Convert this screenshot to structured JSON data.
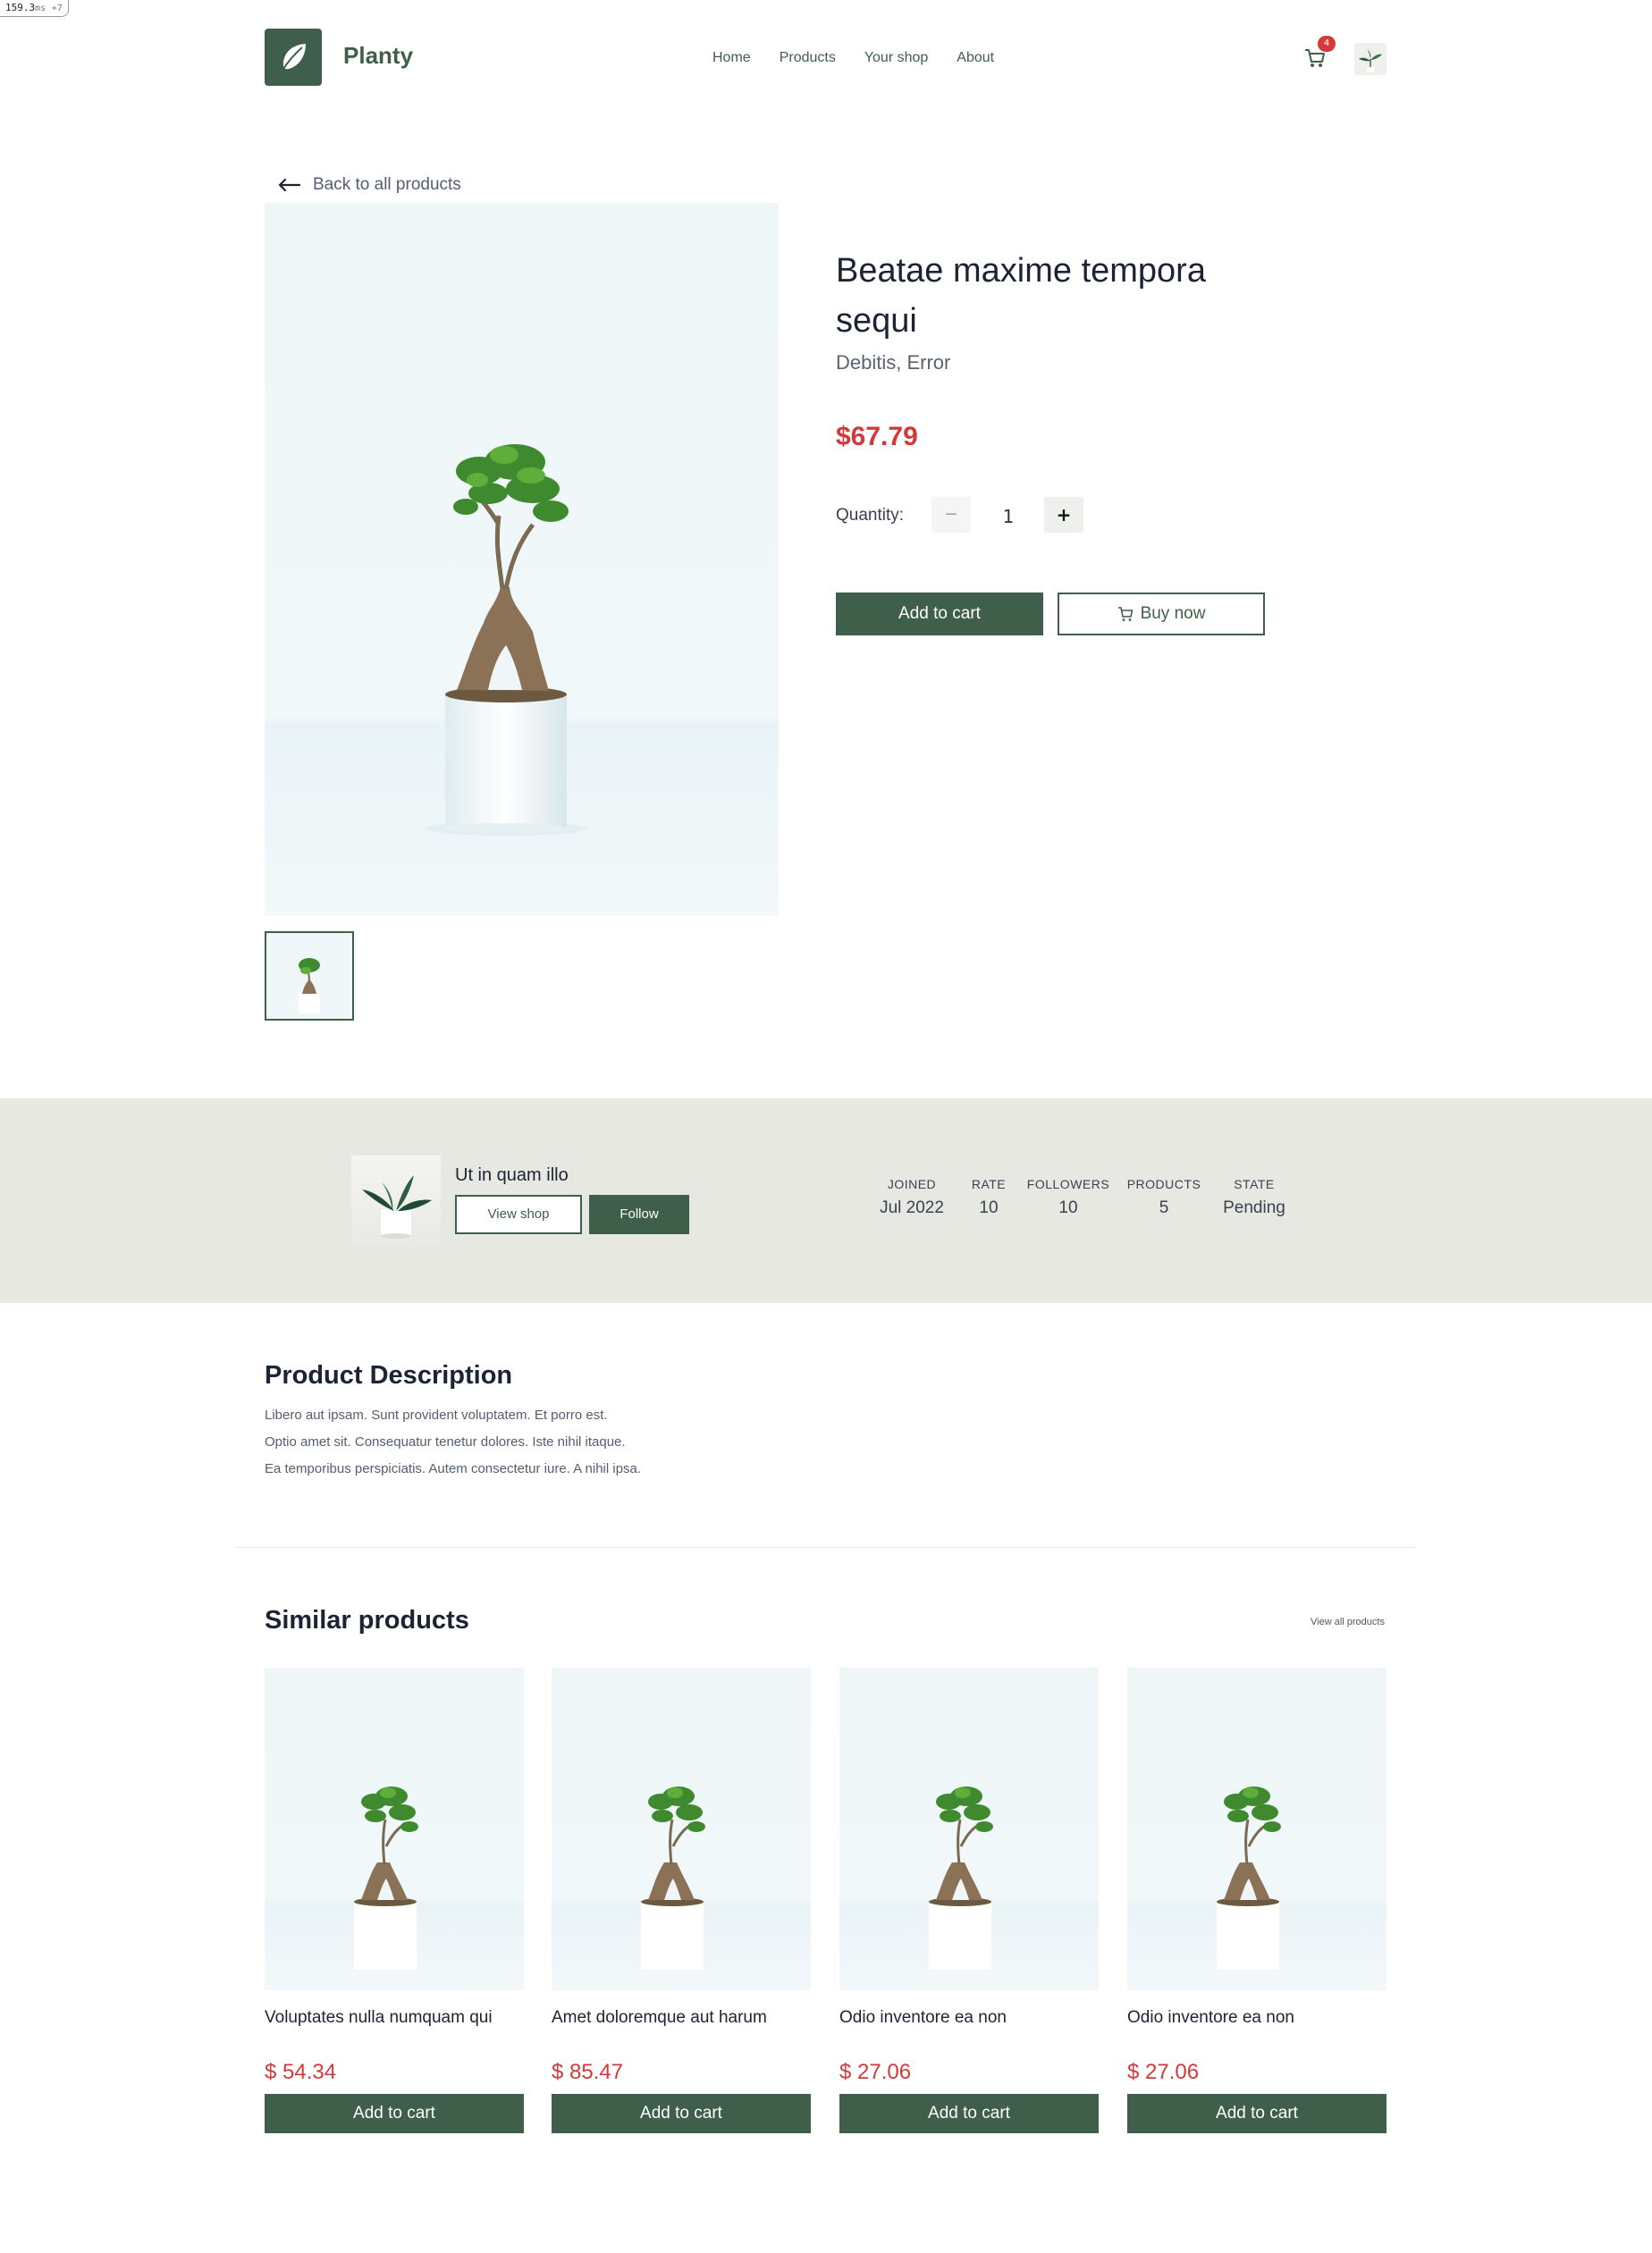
{
  "perf": {
    "value": "159.3",
    "unit": "ms",
    "extra": "+7"
  },
  "header": {
    "brand": "Planty",
    "nav": [
      "Home",
      "Products",
      "Your shop",
      "About"
    ],
    "cart_count": "4"
  },
  "product": {
    "back_label": "Back to all products",
    "title": "Beatae maxime tempora sequi",
    "categories": "Debitis, Error",
    "price": "$67.79",
    "quantity_label": "Quantity:",
    "quantity_minus": "−",
    "quantity_value": "1",
    "quantity_plus": "+",
    "add_to_cart": "Add to cart",
    "buy_now": "Buy now"
  },
  "seller": {
    "name": "Ut in quam illo",
    "view_shop": "View shop",
    "follow": "Follow",
    "stats": [
      {
        "label": "JOINED",
        "value": "Jul 2022"
      },
      {
        "label": "RATE",
        "value": "10"
      },
      {
        "label": "FOLLOWERS",
        "value": "10"
      },
      {
        "label": "PRODUCTS",
        "value": "5"
      },
      {
        "label": "STATE",
        "value": "Pending"
      }
    ]
  },
  "description": {
    "title": "Product Description",
    "lines": [
      "Libero aut ipsam. Sunt provident voluptatem. Et porro est.",
      "Optio amet sit. Consequatur tenetur dolores. Iste nihil itaque.",
      "Ea temporibus perspiciatis. Autem consectetur iure. A nihil ipsa."
    ]
  },
  "similar": {
    "title": "Similar products",
    "view_all": "View all products",
    "items": [
      {
        "name": "Voluptates nulla numquam qui",
        "price": "$ 54.34",
        "button": "Add to cart"
      },
      {
        "name": "Amet doloremque aut harum",
        "price": "$ 85.47",
        "button": "Add to cart"
      },
      {
        "name": "Odio inventore ea non",
        "price": "$ 27.06",
        "button": "Add to cart"
      },
      {
        "name": "Odio inventore ea non",
        "price": "$ 27.06",
        "button": "Add to cart"
      }
    ]
  },
  "colors": {
    "brand": "#3f5f4a",
    "price": "#d23a3a",
    "band": "#e7e8e2"
  }
}
